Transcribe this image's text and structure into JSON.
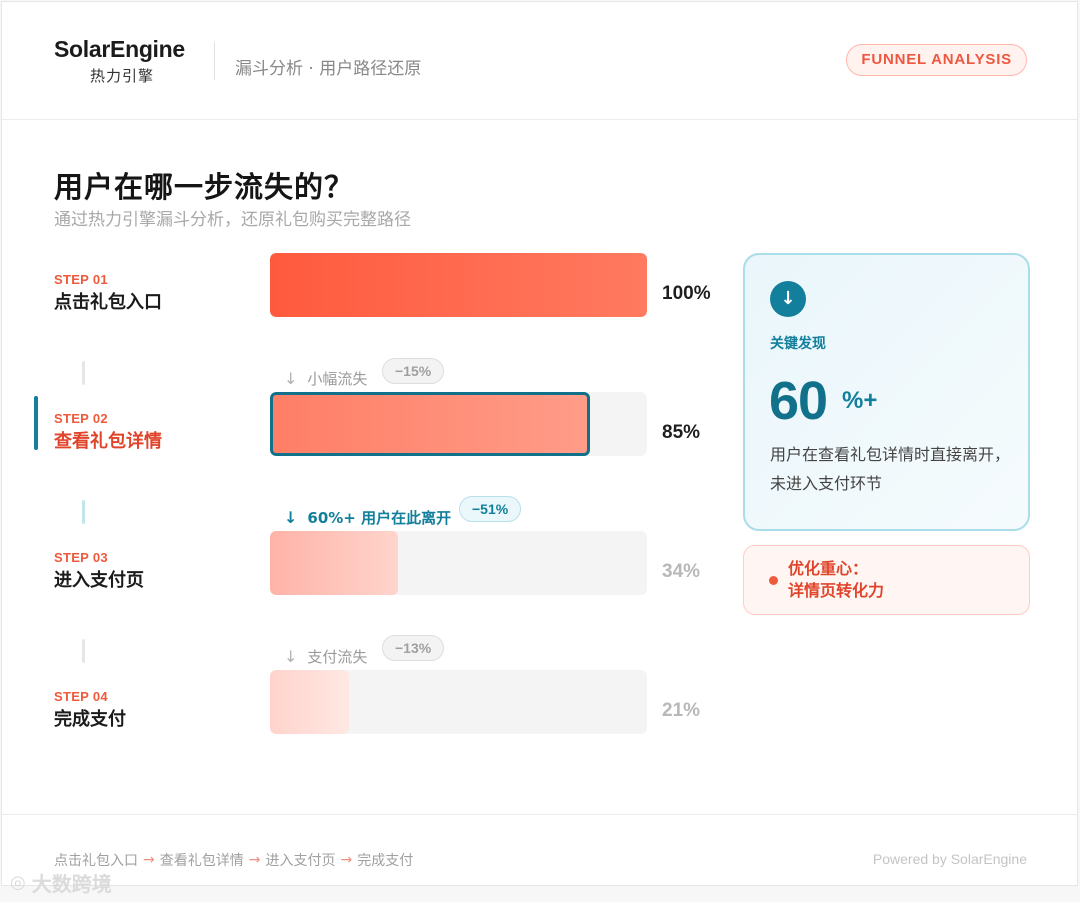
{
  "header": {
    "logo_en": "SolarEngine",
    "logo_cn": "热力引擎",
    "subtitle": "漏斗分析 · 用户路径还原",
    "badge": "FUNNEL ANALYSIS"
  },
  "main": {
    "title": "用户在哪一步流失的？",
    "subtitle": "通过热力引擎漏斗分析，还原礼包购买完整路径"
  },
  "steps": [
    {
      "no": "STEP 01",
      "name": "点击礼包入口",
      "value": 100,
      "pct": "100%"
    },
    {
      "no": "STEP 02",
      "name": "查看礼包详情",
      "value": 85,
      "pct": "85%"
    },
    {
      "no": "STEP 03",
      "name": "进入支付页",
      "value": 34,
      "pct": "34%"
    },
    {
      "no": "STEP 04",
      "name": "完成支付",
      "value": 21,
      "pct": "21%"
    }
  ],
  "drops": [
    {
      "arrow": "↓",
      "text": "小幅流失",
      "pill": "−15%"
    },
    {
      "arrow": "↓",
      "text": "60%+ 用户在此离开",
      "pill": "−51%"
    },
    {
      "arrow": "↓",
      "text": "支付流失",
      "pill": "−13%"
    }
  ],
  "insight": {
    "icon": "↓",
    "icon_name": "arrow-down-icon",
    "label": "关键发现",
    "big": "60",
    "sup": "%+",
    "text": "用户在查看礼包详情时直接离开，未进入支付环节"
  },
  "focus": {
    "line1": "优化重心：",
    "line2": "详情页转化力"
  },
  "footer": {
    "path": [
      "点击礼包入口",
      "查看礼包详情",
      "进入支付页",
      "完成支付"
    ],
    "sep": "→",
    "powered": "Powered by SolarEngine"
  },
  "watermark": {
    "text": "大数跨境"
  },
  "colors": {
    "accent": "#ef5a3c",
    "teal": "#127f9c"
  }
}
